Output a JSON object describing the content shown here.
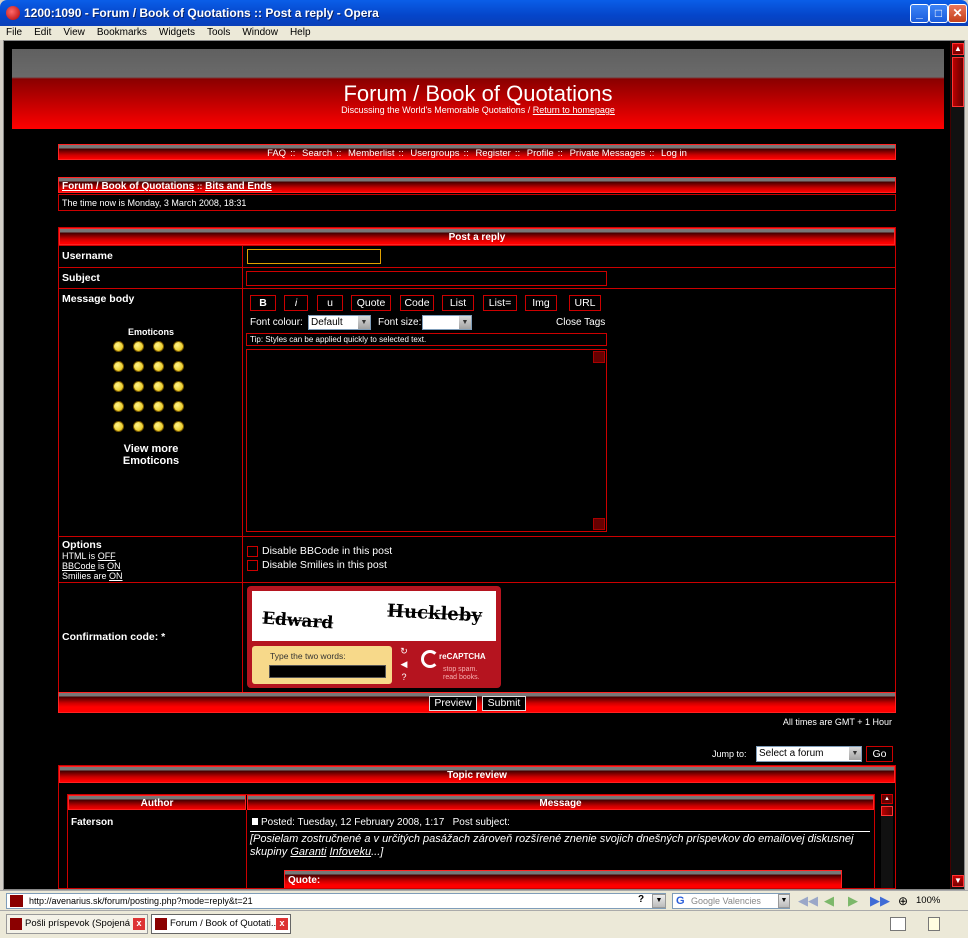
{
  "window": {
    "title": "1200:1090 - Forum / Book of Quotations :: Post a reply - Opera",
    "menu": [
      "File",
      "Edit",
      "View",
      "Bookmarks",
      "Widgets",
      "Tools",
      "Window",
      "Help"
    ]
  },
  "header": {
    "title": "Forum / Book of Quotations",
    "subtitle": "Discussing the World's Memorable Quotations /",
    "home_link": "Return to homepage"
  },
  "nav": [
    "FAQ",
    "Search",
    "Memberlist",
    "Usergroups",
    "Register",
    "Profile",
    "Private Messages",
    "Log in"
  ],
  "nav_sep": "::",
  "breadcrumb": {
    "forum": "Forum / Book of Quotations",
    "sep": "::",
    "topic": "Bits and Ends"
  },
  "time_now": "The time now is Monday, 3 March 2008, 18:31",
  "post_form": {
    "heading": "Post a reply",
    "username_label": "Username",
    "subject_label": "Subject",
    "message_label": "Message body",
    "bbcode_buttons": [
      "B",
      "i",
      "u",
      "Quote",
      "Code",
      "List",
      "List=",
      "Img",
      "URL"
    ],
    "font_colour_label": "Font colour:",
    "font_colour_value": "Default",
    "font_size_label": "Font size:",
    "font_size_value": "",
    "close_tags": "Close Tags",
    "tip": "Tip: Styles can be applied quickly to selected text.",
    "emoticons_heading": "Emoticons",
    "view_more_emoticons": "View more Emoticons",
    "options_label": "Options",
    "html_prefix": "HTML is",
    "html_state": "OFF",
    "bbcode_link": "BBCode",
    "bbcode_mid": "is",
    "bbcode_state": "ON",
    "smilies_prefix": "Smilies are",
    "smilies_state": "ON",
    "disable_bbcode": "Disable BBCode in this post",
    "disable_smilies": "Disable Smilies in this post",
    "confirmation_label": "Confirmation code: *",
    "captcha_word1": "Edward",
    "captcha_word2": "Huckleby",
    "captcha_prompt": "Type the two words:",
    "recaptcha_brand": "reCAPTCHA",
    "recaptcha_tagline1": "stop spam.",
    "recaptcha_tagline2": "read books.",
    "preview_button": "Preview",
    "submit_button": "Submit"
  },
  "timezone_note": "All times are GMT + 1 Hour",
  "jump": {
    "label": "Jump to:",
    "select_value": "Select a forum",
    "go_button": "Go"
  },
  "topic_review": {
    "heading": "Topic review",
    "col_author": "Author",
    "col_message": "Message",
    "author": "Faterson",
    "posted": "Posted: Tuesday, 12 February 2008, 1:17",
    "post_subject_label": "Post subject:",
    "text_start": "[Posielam zostručnené a v určitých pasážach zároveň rozšírené znenie svojich dnešných príspevkov do emailovej diskusnej skupiny",
    "link1": "Garanti",
    "link2": "Infoveku",
    "text_end": "...]",
    "quote_label": "Quote:"
  },
  "statusbar": {
    "url": "http://avenarius.sk/forum/posting.php?mode=reply&t=21",
    "search_placeholder": "Google Valencies",
    "zoom": "100%"
  },
  "tabs": [
    {
      "label": "Pošli príspevok (Spojená ..."
    },
    {
      "label": "Forum / Book of Quotati..."
    }
  ],
  "colors": {
    "accent_red": "#ff0000",
    "dark_red": "#cc0000",
    "background": "#000000"
  }
}
